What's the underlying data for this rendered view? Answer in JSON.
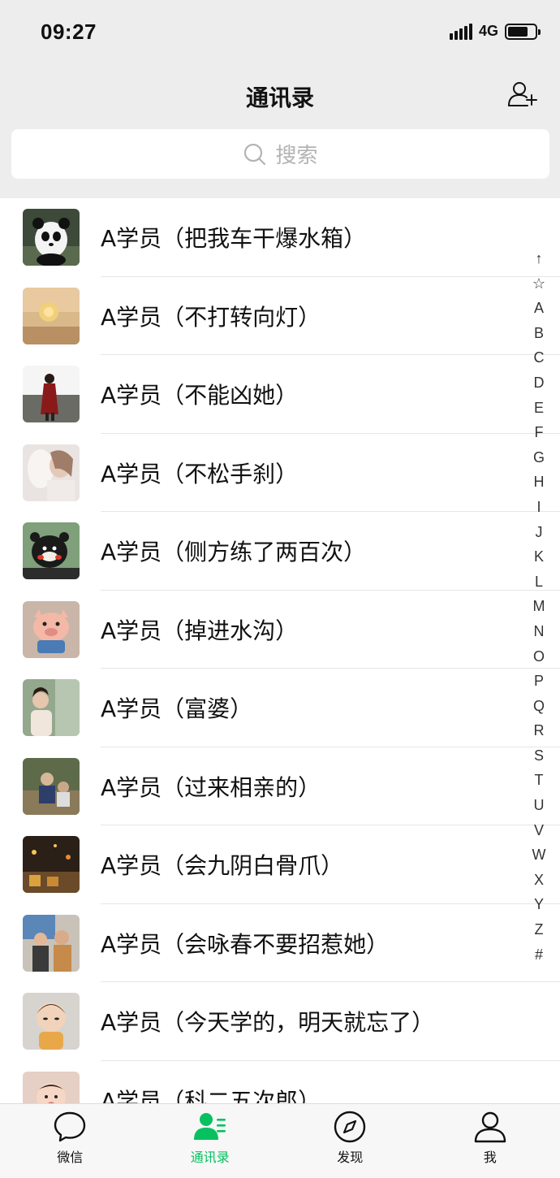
{
  "status_bar": {
    "time": "09:27",
    "network": "4G"
  },
  "header": {
    "title": "通讯录",
    "add_icon": "add-friend-icon"
  },
  "search": {
    "placeholder": "搜索",
    "icon": "search-icon"
  },
  "contacts": [
    {
      "name": "A学员（把我车干爆水箱）",
      "avatar": "panda"
    },
    {
      "name": "A学员（不打转向灯）",
      "avatar": "sunset"
    },
    {
      "name": "A学员（不能凶她）",
      "avatar": "girl-red"
    },
    {
      "name": "A学员（不松手刹）",
      "avatar": "girl-kiss"
    },
    {
      "name": "A学员（侧方练了两百次）",
      "avatar": "kumamon"
    },
    {
      "name": "A学员（掉进水沟）",
      "avatar": "piggy"
    },
    {
      "name": "A学员（富婆）",
      "avatar": "woman-window"
    },
    {
      "name": "A学员（过来相亲的）",
      "avatar": "people-outdoor"
    },
    {
      "name": "A学员（会九阴白骨爪）",
      "avatar": "night-lights"
    },
    {
      "name": "A学员（会咏春不要招惹她）",
      "avatar": "kids"
    },
    {
      "name": "A学员（今天学的，明天就忘了）",
      "avatar": "cartoon-boy"
    },
    {
      "name": "A学员（科二五次郎）",
      "avatar": "baby"
    }
  ],
  "index_bar": [
    "↑",
    "☆",
    "A",
    "B",
    "C",
    "D",
    "E",
    "F",
    "G",
    "H",
    "I",
    "J",
    "K",
    "L",
    "M",
    "N",
    "O",
    "P",
    "Q",
    "R",
    "S",
    "T",
    "U",
    "V",
    "W",
    "X",
    "Y",
    "Z",
    "#"
  ],
  "tabs": [
    {
      "label": "微信",
      "icon": "chat-bubble-icon",
      "active": false
    },
    {
      "label": "通讯录",
      "icon": "contacts-icon",
      "active": true
    },
    {
      "label": "发现",
      "icon": "compass-icon",
      "active": false
    },
    {
      "label": "我",
      "icon": "person-icon",
      "active": false
    }
  ],
  "colors": {
    "accent": "#07c160",
    "background": "#ededed",
    "list_background": "#ffffff"
  }
}
